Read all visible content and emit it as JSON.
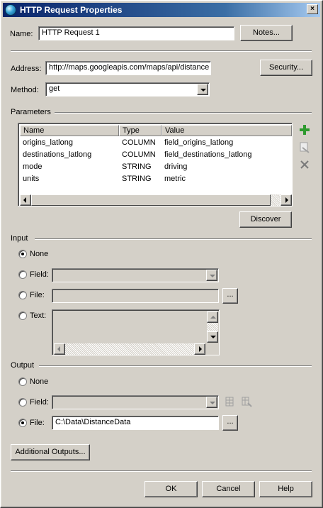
{
  "window": {
    "title": "HTTP Request Properties",
    "close_glyph": "×"
  },
  "name": {
    "label": "Name:",
    "value": "HTTP Request 1",
    "notes_button": "Notes..."
  },
  "address": {
    "label": "Address:",
    "value": "http://maps.googleapis.com/maps/api/distance",
    "security_button": "Security..."
  },
  "method": {
    "label": "Method:",
    "value": "get"
  },
  "parameters": {
    "section_label": "Parameters",
    "columns": [
      "Name",
      "Type",
      "Value"
    ],
    "rows": [
      {
        "name": "origins_latlong",
        "type": "COLUMN",
        "value": "field_origins_latlong"
      },
      {
        "name": "destinations_latlong",
        "type": "COLUMN",
        "value": "field_destinations_latlong"
      },
      {
        "name": "mode",
        "type": "STRING",
        "value": "driving"
      },
      {
        "name": "units",
        "type": "STRING",
        "value": "metric"
      }
    ],
    "discover_button": "Discover",
    "icons": [
      "add-icon",
      "edit-icon",
      "delete-icon"
    ],
    "colors": {
      "add": "#2e9a2e",
      "delete": "#7a7a7a"
    }
  },
  "input": {
    "section_label": "Input",
    "options": {
      "none": "None",
      "field": "Field:",
      "file": "File:",
      "text": "Text:"
    },
    "selected": "none",
    "browse_button": "..."
  },
  "output": {
    "section_label": "Output",
    "options": {
      "none": "None",
      "field": "Field:",
      "file": "File:"
    },
    "selected": "file",
    "file_value": "C:\\Data\\DistanceData",
    "browse_button": "..."
  },
  "footer": {
    "additional_outputs_button": "Additional Outputs...",
    "ok_button": "OK",
    "cancel_button": "Cancel",
    "help_button": "Help"
  }
}
